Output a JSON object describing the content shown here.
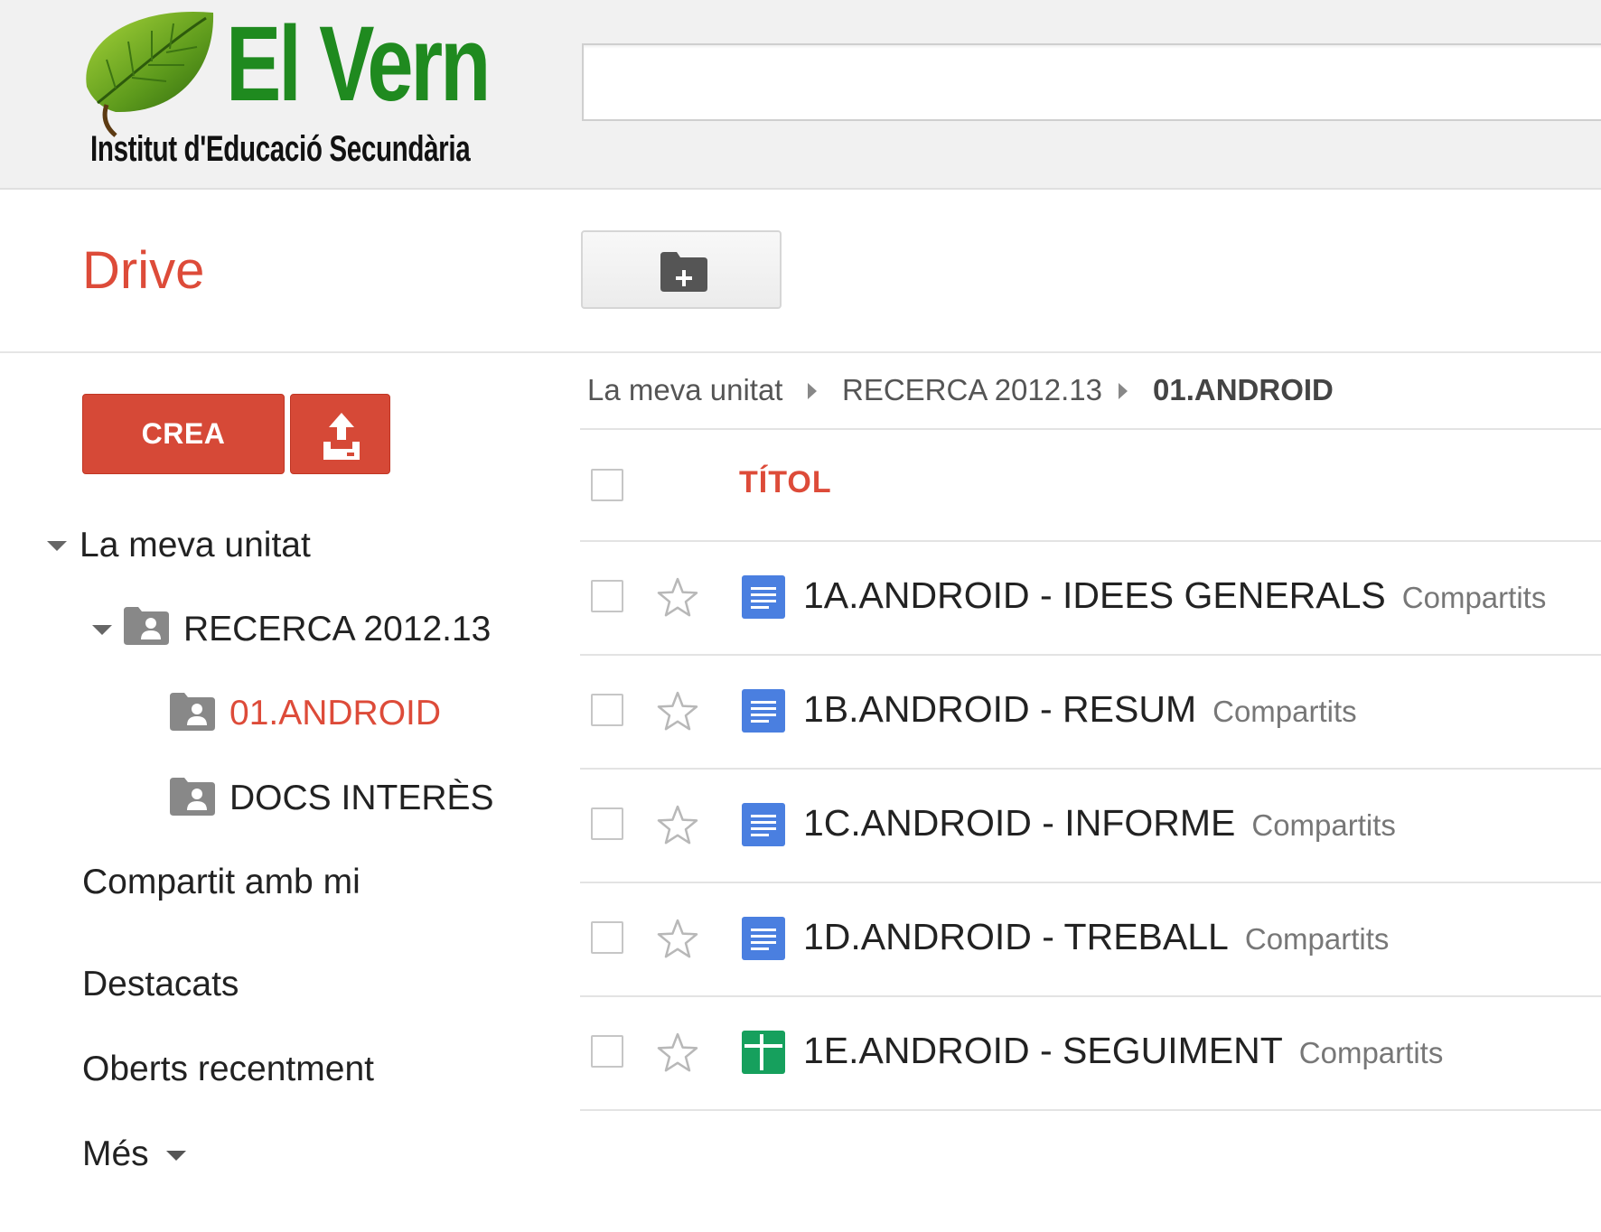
{
  "header": {
    "logo_name": "El Vern",
    "logo_subtitle": "Institut d'Educació Secundària",
    "search_value": ""
  },
  "app_title": "Drive",
  "toolbar": {
    "new_folder_icon": "folder-plus-icon"
  },
  "sidebar": {
    "create_label": "CREA",
    "upload_icon": "upload-icon",
    "items": [
      {
        "label": "La meva unitat",
        "expanded": true
      },
      {
        "label": "RECERCA 2012.13",
        "expanded": true,
        "icon": "shared-folder-icon"
      },
      {
        "label": "01.ANDROID",
        "active": true,
        "icon": "shared-folder-icon"
      },
      {
        "label": "DOCS INTERÈS",
        "icon": "shared-folder-icon"
      },
      {
        "label": "Compartit amb mi"
      },
      {
        "label": "Destacats"
      },
      {
        "label": "Oberts recentment"
      },
      {
        "label": "Més",
        "has_dropdown": true
      }
    ]
  },
  "breadcrumb": [
    "La meva unitat",
    "RECERCA 2012.13",
    "01.ANDROID"
  ],
  "list": {
    "column_title": "TÍTOL",
    "files": [
      {
        "name": "1A.ANDROID - IDEES GENERALS",
        "status": "Compartits",
        "type": "document"
      },
      {
        "name": "1B.ANDROID - RESUM",
        "status": "Compartits",
        "type": "document"
      },
      {
        "name": "1C.ANDROID - INFORME",
        "status": "Compartits",
        "type": "document"
      },
      {
        "name": "1D.ANDROID - TREBALL",
        "status": "Compartits",
        "type": "document"
      },
      {
        "name": "1E.ANDROID - SEGUIMENT",
        "status": "Compartits",
        "type": "spreadsheet"
      }
    ]
  },
  "colors": {
    "accent_red": "#dd4b39",
    "button_red": "#d64937",
    "doc_blue": "#4a7fe0",
    "sheet_green": "#16a05d",
    "logo_green": "#1f8a1f"
  }
}
